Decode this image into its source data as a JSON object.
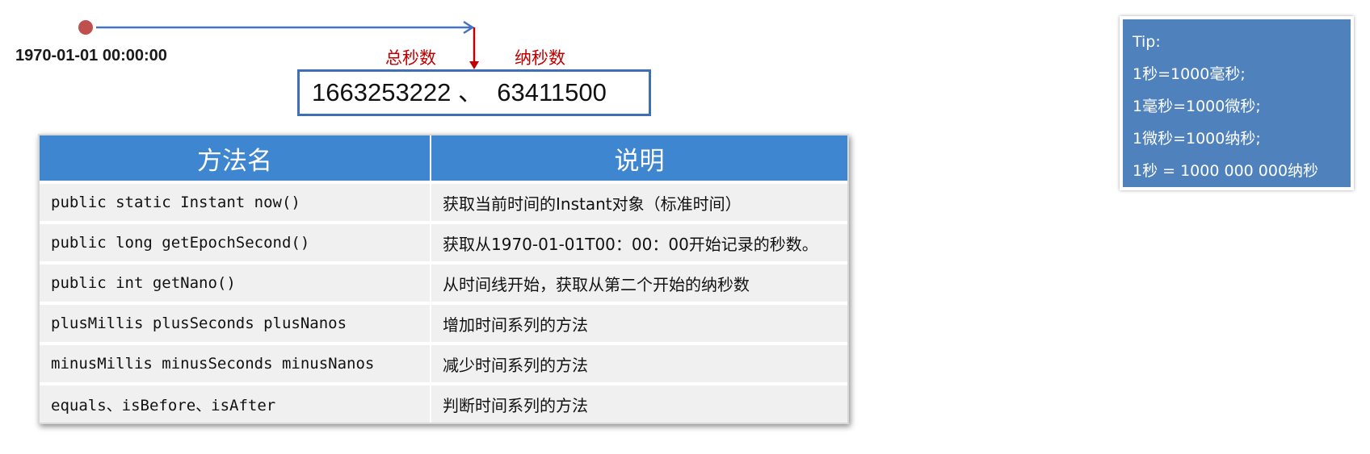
{
  "timeline": {
    "epoch_label": "1970-01-01 00:00:00",
    "seconds_label": "总秒数",
    "nanos_label": "纳秒数",
    "value_text": "1663253222 、  63411500",
    "colors": {
      "arrow": "#4472c4",
      "marker": "#c0504d",
      "pointer": "#c00000",
      "box_border": "#3f6fb5"
    }
  },
  "table": {
    "headers": [
      "方法名",
      "说明"
    ],
    "header_color": "#3f86d0",
    "rows": [
      {
        "method": "public static Instant now()",
        "description": "获取当前时间的Instant对象（标准时间）"
      },
      {
        "method": "public long getEpochSecond()",
        "description": "获取从1970-01-01T00：00：00开始记录的秒数。"
      },
      {
        "method": "public int getNano()",
        "description": "从时间线开始，获取从第二个开始的纳秒数"
      },
      {
        "method": "plusMillis plusSeconds plusNanos",
        "description": "增加时间系列的方法"
      },
      {
        "method": "minusMillis minusSeconds minusNanos",
        "description": "减少时间系列的方法"
      },
      {
        "method": "equals、isBefore、isAfter",
        "description": "判断时间系列的方法"
      }
    ]
  },
  "tip": {
    "lines": [
      "Tip:",
      "1秒=1000毫秒;",
      "1毫秒=1000微秒;",
      "1微秒=1000纳秒;",
      "1秒 = 1000 000 000纳秒"
    ],
    "background": "#4f81bd"
  }
}
